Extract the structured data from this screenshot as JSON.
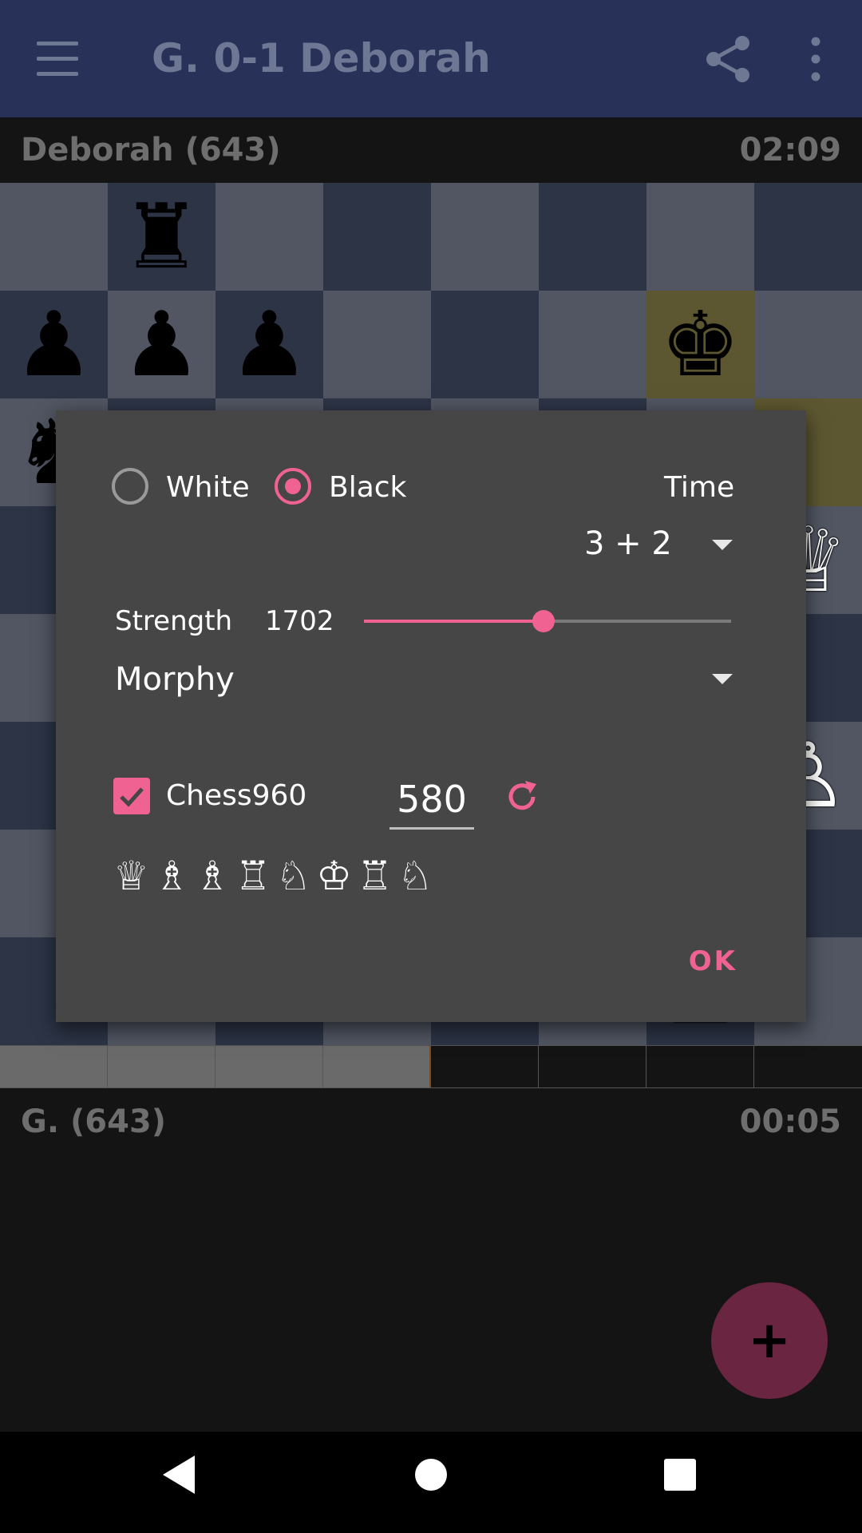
{
  "app_bar": {
    "title": "G. 0-1 Deborah",
    "menu_icon": "hamburger-icon",
    "share_icon": "share-icon",
    "more_icon": "more-vert-icon"
  },
  "top_player": {
    "name": "Deborah (643)",
    "clock": "02:09"
  },
  "bottom_player": {
    "name": "G. (643)",
    "clock": "00:05"
  },
  "board": {
    "colors": {
      "light": "#515662",
      "dark": "#2c3446",
      "highlight": "#5d5731"
    },
    "pieces_visible": [
      {
        "square": "b8",
        "glyph": "♜",
        "color": "black"
      },
      {
        "square": "a7",
        "glyph": "♟",
        "color": "black"
      },
      {
        "square": "b7",
        "glyph": "♟",
        "color": "black"
      },
      {
        "square": "c7",
        "glyph": "♟",
        "color": "black"
      },
      {
        "square": "g7",
        "glyph": "♚",
        "color": "black"
      },
      {
        "square": "a6",
        "glyph": "♞",
        "color": "black"
      },
      {
        "square": "h5",
        "glyph": "♕",
        "color": "white"
      },
      {
        "square": "h3",
        "glyph": "♙",
        "color": "white"
      },
      {
        "square": "g1",
        "glyph": "♙",
        "color": "white"
      }
    ],
    "highlighted_squares": [
      "g7",
      "h6"
    ]
  },
  "dialog": {
    "white_label": "White",
    "black_label": "Black",
    "selected_side": "Black",
    "time_label": "Time",
    "time_value": "3 + 2",
    "strength_label": "Strength",
    "strength_value": "1702",
    "strength_fraction": 0.49,
    "engine_value": "Morphy",
    "chess960_label": "Chess960",
    "chess960_checked": true,
    "chess960_seed": "580",
    "refresh_icon": "refresh-icon",
    "setup_pieces": "♕♗♗♖♘♔♖♘",
    "ok_label": "OK",
    "accent_color": "#f06292"
  },
  "fab": {
    "label": "+",
    "icon": "add-icon"
  },
  "nav_bar": {
    "back_icon": "back-icon",
    "home_icon": "home-icon",
    "recents_icon": "recents-icon"
  }
}
